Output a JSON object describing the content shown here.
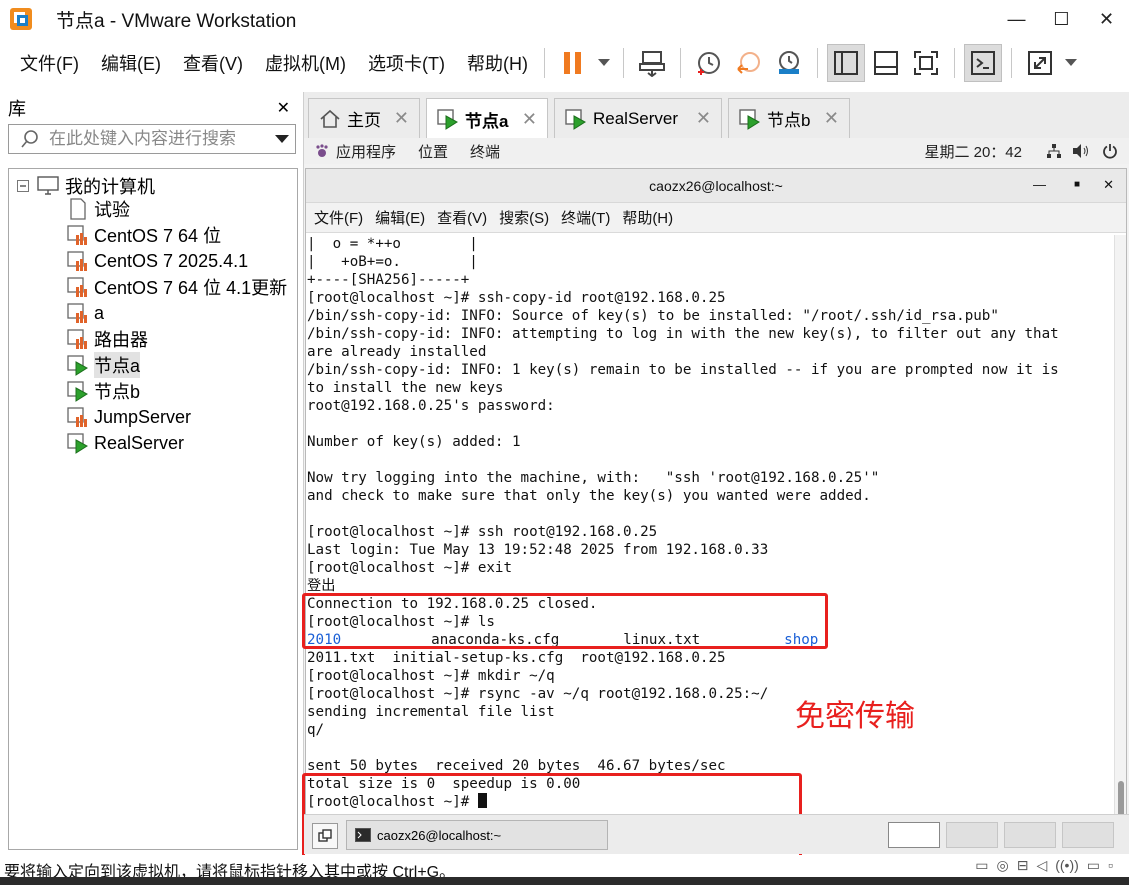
{
  "window": {
    "title": "节点a - VMware Workstation",
    "minimize": "—",
    "maximize": "☐",
    "close": "✕"
  },
  "menubar": {
    "items": [
      "文件(F)",
      "编辑(E)",
      "查看(V)",
      "虚拟机(M)",
      "选项卡(T)",
      "帮助(H)"
    ]
  },
  "toolbar": {
    "icons": [
      "pause-icon",
      "dropdown-arrow-icon",
      "send-ctrl-alt-del-icon",
      "snapshot-icon",
      "revert-snapshot-icon",
      "snapshot-manager-icon",
      "library-view-icon",
      "thumbnail-view-icon",
      "fullscreen-icon",
      "console-view-icon",
      "stretch-icon",
      "dropdown-arrow-icon"
    ],
    "accent": "#f07a20"
  },
  "library": {
    "title": "库",
    "close": "✕",
    "search_placeholder": "在此处键入内容进行搜索",
    "root": "我的计算机",
    "items": [
      {
        "label": "试验",
        "state": "off-doc"
      },
      {
        "label": "CentOS 7 64 位",
        "state": "off"
      },
      {
        "label": "CentOS 7 2025.4.1",
        "state": "off"
      },
      {
        "label": "CentOS 7 64 位 4.1更新",
        "state": "off"
      },
      {
        "label": "a",
        "state": "off"
      },
      {
        "label": "路由器",
        "state": "off"
      },
      {
        "label": "节点a",
        "state": "running",
        "selected": true
      },
      {
        "label": "节点b",
        "state": "running"
      },
      {
        "label": "JumpServer",
        "state": "off"
      },
      {
        "label": "RealServer",
        "state": "running"
      }
    ]
  },
  "tabs": [
    {
      "label": "主页",
      "icon": "home-icon"
    },
    {
      "label": "节点a",
      "icon": "vm-running-icon",
      "active": true
    },
    {
      "label": "RealServer",
      "icon": "vm-running-icon"
    },
    {
      "label": "节点b",
      "icon": "vm-running-icon"
    }
  ],
  "gnome": {
    "apps": "应用程序",
    "places": "位置",
    "terminal": "终端",
    "clock": "星期二 20：42"
  },
  "terminal": {
    "title": "caozx26@localhost:~",
    "menu": [
      "文件(F)",
      "编辑(E)",
      "查看(V)",
      "搜索(S)",
      "终端(T)",
      "帮助(H)"
    ],
    "lines": [
      "|  o = *++o        |",
      "|   +oB+=o.        |",
      "+----[SHA256]-----+",
      "[root@localhost ~]# ssh-copy-id root@192.168.0.25",
      "/bin/ssh-copy-id: INFO: Source of key(s) to be installed: \"/root/.ssh/id_rsa.pub\"",
      "/bin/ssh-copy-id: INFO: attempting to log in with the new key(s), to filter out any that",
      "are already installed",
      "/bin/ssh-copy-id: INFO: 1 key(s) remain to be installed -- if you are prompted now it is",
      "to install the new keys",
      "root@192.168.0.25's password:",
      "",
      "Number of key(s) added: 1",
      "",
      "Now try logging into the machine, with:   \"ssh 'root@192.168.0.25'\"",
      "and check to make sure that only the key(s) you wanted were added.",
      "",
      "[root@localhost ~]# ssh root@192.168.0.25",
      "Last login: Tue May 13 19:52:48 2025 from 192.168.0.33",
      "[root@localhost ~]# exit",
      "登出",
      "Connection to 192.168.0.25 closed.",
      "[root@localhost ~]# ls",
      "",
      "2011.txt  initial-setup-ks.cfg  root@192.168.0.25",
      "[root@localhost ~]# mkdir ~/q",
      "[root@localhost ~]# rsync -av ~/q root@192.168.0.25:~/",
      "sending incremental file list",
      "q/",
      "",
      "sent 50 bytes  received 20 bytes  46.67 bytes/sec",
      "total size is 0  speedup is 0.00",
      "[root@localhost ~]# "
    ],
    "ls_row": {
      "dir1": "2010",
      "file1": "anaconda-ks.cfg",
      "file2": "linux.txt",
      "dir2": "shop"
    },
    "dir_color": "#1a5fd6",
    "annotation": "免密传输",
    "annotation_color": "#e8201e"
  },
  "vm_taskbar": {
    "task_label": "caozx26@localhost:~"
  },
  "statusbar": {
    "text": "要将输入定向到该虚拟机，请将鼠标指针移入其中或按 Ctrl+G。"
  }
}
